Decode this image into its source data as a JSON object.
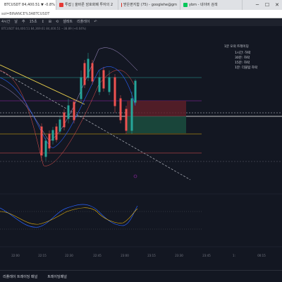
{
  "browser": {
    "tabs": [
      {
        "label": "BTCUSDT 84,400.51 ▼ -0.8% 마.",
        "color": "#2962ff",
        "active": true
      },
      {
        "label": "투잡 | 올바른 암호화폐 투자의 2",
        "color": "#e53935",
        "active": false
      },
      {
        "label": "받은편지함 (75) - googlehe@gm",
        "color": "#d93025",
        "active": false
      },
      {
        "label": "ybm - 네이버 검색",
        "color": "#03c75a",
        "active": false
      }
    ],
    "address": "sol=BINANCE%3ABTCUSDT"
  },
  "toolbar": {
    "items": [
      "4시간",
      "날",
      "주",
      "15초",
      "↕",
      "⊞",
      "⟲",
      "셀레트",
      "리플레이",
      "↶"
    ]
  },
  "ohlc": {
    "text": "BTCUSDT  84,400.51  84,369.61  84,400.51  −38.89 (+0.04%)"
  },
  "right_panel": {
    "title": "1분 오의 트레이딩",
    "lines": [
      "1시간: 하락",
      "30분: 하락",
      "15분: 하락",
      "1분: 더블탑 하락"
    ]
  },
  "x_ticks": [
    "22:00",
    "22:15",
    "22:30",
    "22:45",
    "23:00",
    "23:15",
    "23:30",
    "23:45",
    "1:",
    "00:15"
  ],
  "bottom": {
    "items": [
      "리플레이 트레이딩 패널",
      "트레이딩패널"
    ]
  }
}
